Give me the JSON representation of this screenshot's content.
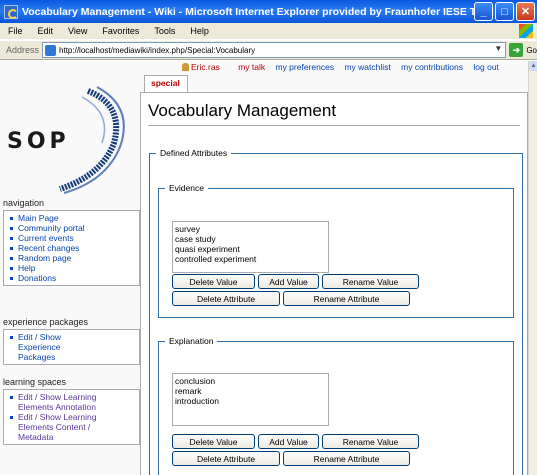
{
  "window": {
    "title": "Vocabulary Management - Wiki - Microsoft Internet Explorer provided by Fraunhofer IESE T...",
    "buttons": {
      "minimize": "_",
      "maximize": "□",
      "close": "✕"
    }
  },
  "menu": [
    "File",
    "Edit",
    "View",
    "Favorites",
    "Tools",
    "Help"
  ],
  "address": {
    "label": "Address",
    "url": "http://localhost/mediawiki/index.php/Special:Vocabulary",
    "go_label": "Go"
  },
  "personal": {
    "user": "Eric.ras",
    "links": [
      "my talk",
      "my preferences",
      "my watchlist",
      "my contributions",
      "log out"
    ]
  },
  "tab": "special",
  "logo_text": "SOP",
  "sidebar": {
    "navigation": {
      "heading": "navigation",
      "items": [
        "Main Page",
        "Community portal",
        "Current events",
        "Recent changes",
        "Random page",
        "Help",
        "Donations"
      ]
    },
    "experience": {
      "heading": "experience packages",
      "items": [
        "Edit / Show Experience Packages"
      ]
    },
    "learning": {
      "heading": "learning spaces",
      "items": [
        "Edit / Show Learning Elements Annotation",
        "Edit / Show Learning Elements Content / Metadata"
      ]
    }
  },
  "page_title": "Vocabulary Management",
  "defined_attributes": "Defined Attributes",
  "attributes": [
    {
      "name": "Evidence",
      "values": [
        "survey",
        "case study",
        "quasi experiment",
        "controlled experiment"
      ]
    },
    {
      "name": "Explanation",
      "values": [
        "conclusion",
        "remark",
        "introduction"
      ]
    }
  ],
  "buttons": {
    "delete_value": "Delete Value",
    "add_value": "Add Value",
    "rename_value": "Rename Value",
    "delete_attribute": "Delete Attribute",
    "rename_attribute": "Rename Attribute"
  }
}
